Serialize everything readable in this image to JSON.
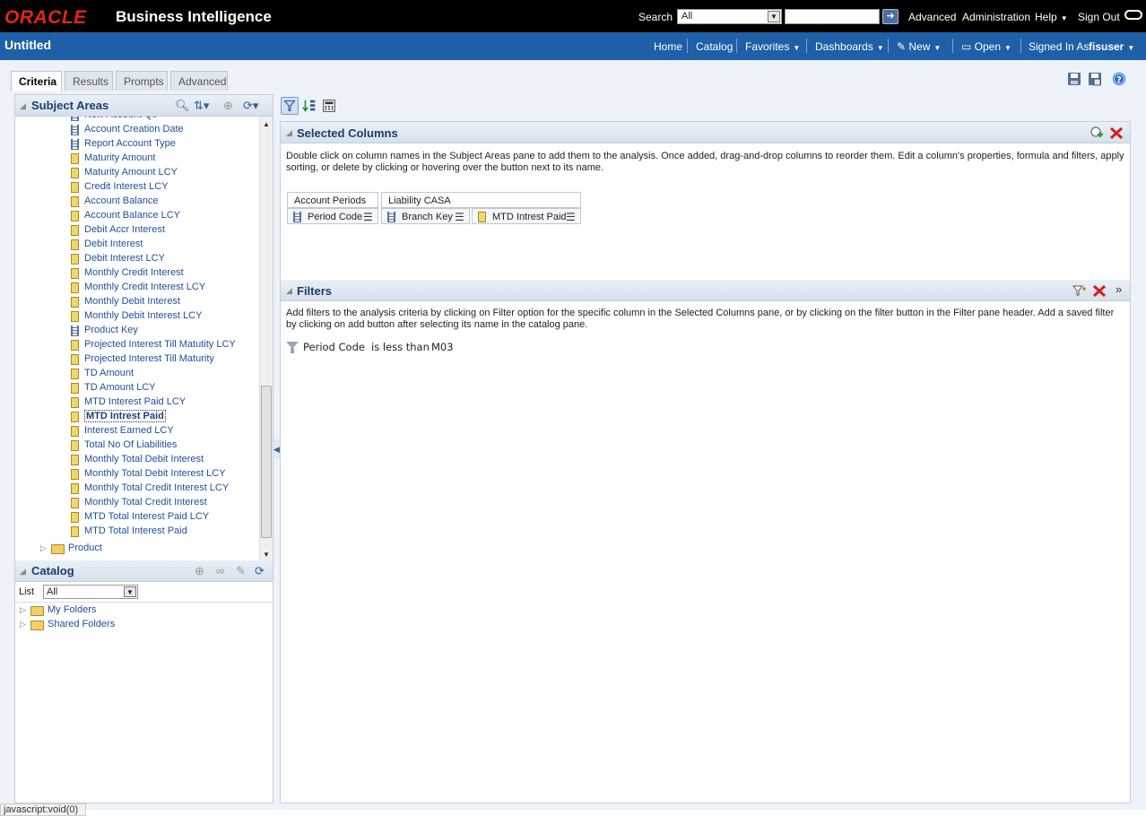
{
  "topbar": {
    "logo": "ORACLE",
    "product": "Business Intelligence",
    "search_label": "Search",
    "search_scope": "All",
    "search_query": "",
    "links": [
      "Advanced",
      "Administration",
      "Help",
      "Sign Out"
    ]
  },
  "bluebar": {
    "title": "Untitled",
    "nav": [
      "Home",
      "Catalog",
      "Favorites",
      "Dashboards",
      "New",
      "Open"
    ],
    "signed_in_label": "Signed In As",
    "user": "fisuser"
  },
  "tabs": [
    "Criteria",
    "Results",
    "Prompts",
    "Advanced"
  ],
  "subject_areas": {
    "title": "Subject Areas",
    "items": [
      {
        "label": "New Account Qti",
        "type": "attr"
      },
      {
        "label": "Account Creation Date",
        "type": "attr"
      },
      {
        "label": "Report Account Type",
        "type": "attr"
      },
      {
        "label": "Maturity Amount",
        "type": "measure"
      },
      {
        "label": "Maturity Amount LCY",
        "type": "measure"
      },
      {
        "label": "Credit Interest LCY",
        "type": "measure"
      },
      {
        "label": "Account Balance",
        "type": "measure"
      },
      {
        "label": "Account Balance LCY",
        "type": "measure"
      },
      {
        "label": "Debit Accr Interest",
        "type": "measure"
      },
      {
        "label": "Debit Interest",
        "type": "measure"
      },
      {
        "label": "Debit Interest LCY",
        "type": "measure"
      },
      {
        "label": "Monthly Credit Interest",
        "type": "measure"
      },
      {
        "label": "Monthly Credit Interest LCY",
        "type": "measure"
      },
      {
        "label": "Monthly Debit Interest",
        "type": "measure"
      },
      {
        "label": "Monthly Debit Interest LCY",
        "type": "measure"
      },
      {
        "label": "Product Key",
        "type": "attr"
      },
      {
        "label": "Projected Interest Till Matutity LCY",
        "type": "measure"
      },
      {
        "label": "Projected Interest Till Maturity",
        "type": "measure"
      },
      {
        "label": "TD Amount",
        "type": "measure"
      },
      {
        "label": "TD Amount LCY",
        "type": "measure"
      },
      {
        "label": "MTD Interest Paid LCY",
        "type": "measure"
      },
      {
        "label": "MTD Intrest Paid",
        "type": "measure",
        "selected": true
      },
      {
        "label": "Interest Earned LCY",
        "type": "measure"
      },
      {
        "label": "Total No Of Liabilities",
        "type": "measure"
      },
      {
        "label": "Monthly Total Debit Interest",
        "type": "measure"
      },
      {
        "label": "Monthly Total Debit Interest LCY",
        "type": "measure"
      },
      {
        "label": "Monthly Total Credit Interest LCY",
        "type": "measure"
      },
      {
        "label": "Monthly Total Credit Interest",
        "type": "measure"
      },
      {
        "label": "MTD Total Interest Paid LCY",
        "type": "measure"
      },
      {
        "label": "MTD Total Interest Paid",
        "type": "measure"
      }
    ],
    "folder": "Product"
  },
  "catalog": {
    "title": "Catalog",
    "list_label": "List",
    "list_value": "All",
    "folders": [
      "My Folders",
      "Shared Folders"
    ]
  },
  "selected_columns": {
    "title": "Selected Columns",
    "help": "Double click on column names in the Subject Areas pane to add them to the analysis. Once added, drag-and-drop columns to reorder them. Edit a column's properties, formula and filters, apply sorting, or delete by clicking or hovering over the button next to its name.",
    "groups": [
      "Account Periods",
      "Liability CASA"
    ],
    "columns": [
      "Period Code",
      "Branch Key",
      "MTD Intrest Paid"
    ]
  },
  "filters": {
    "title": "Filters",
    "help": "Add filters to the analysis criteria by clicking on Filter option for the specific column in the Selected Columns pane, or by clicking on the filter button in the Filter pane header. Add a saved filter by clicking on add button after selecting its name in the catalog pane.",
    "column": "Period Code",
    "operator": "is less than",
    "value": "M03"
  },
  "status": "javascript:void(0)"
}
